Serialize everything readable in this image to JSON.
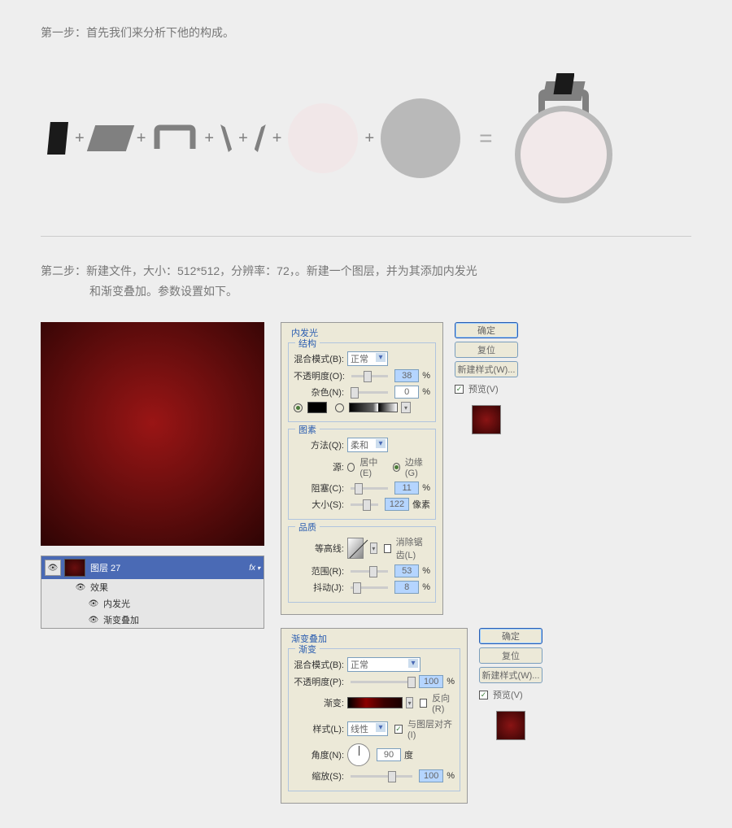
{
  "step1": {
    "title": "第一步：首先我们来分析下他的构成。"
  },
  "step2": {
    "title_line1": "第二步：新建文件，大小：512*512，分辨率：72，。新建一个图层，并为其添加内发光",
    "title_line2": "和渐变叠加。参数设置如下。"
  },
  "symbols": {
    "plus": "+",
    "equals": "="
  },
  "layers": {
    "layer_name": "图层 27",
    "fx": "fx",
    "effects": "效果",
    "inner_glow": "内发光",
    "grad_overlay": "渐变叠加"
  },
  "inner_glow_panel": {
    "title": "内发光",
    "structure": "结构",
    "blend_mode_label": "混合模式(B):",
    "blend_mode_value": "正常",
    "opacity_label": "不透明度(O):",
    "opacity_value": "38",
    "noise_label": "杂色(N):",
    "noise_value": "0",
    "elements": "图素",
    "method_label": "方法(Q):",
    "method_value": "柔和",
    "source_label": "源:",
    "center": "居中(E)",
    "edge": "边缘(G)",
    "choke_label": "阻塞(C):",
    "choke_value": "11",
    "size_label": "大小(S):",
    "size_value": "122",
    "size_unit": "像素",
    "quality": "品质",
    "contour_label": "等高线:",
    "antialiased": "消除锯齿(L)",
    "range_label": "范围(R):",
    "range_value": "53",
    "jitter_label": "抖动(J):",
    "jitter_value": "8",
    "pct": "%"
  },
  "grad_overlay_panel": {
    "title": "渐变叠加",
    "gradient_section": "渐变",
    "blend_mode_label": "混合模式(B):",
    "blend_mode_value": "正常",
    "opacity_label": "不透明度(P):",
    "opacity_value": "100",
    "gradient_label": "渐变:",
    "reverse": "反向(R)",
    "style_label": "样式(L):",
    "style_value": "线性",
    "align_with_layer": "与图层对齐(I)",
    "angle_label": "角度(N):",
    "angle_value": "90",
    "angle_unit": "度",
    "scale_label": "缩放(S):",
    "scale_value": "100",
    "pct": "%"
  },
  "buttons": {
    "ok": "确定",
    "reset": "复位",
    "new_style": "新建样式(W)...",
    "preview": "预览(V)"
  }
}
